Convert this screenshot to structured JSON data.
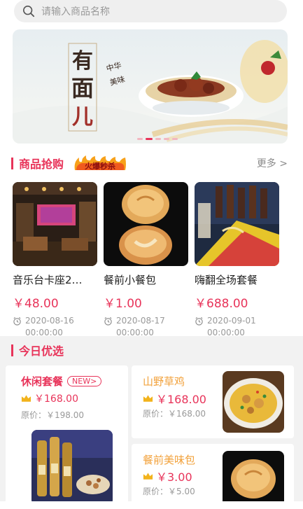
{
  "search": {
    "placeholder": "请输入商品名称",
    "icon": "search-icon"
  },
  "banner": {
    "title_glyphs": "有面儿",
    "subtitle": "中华美味",
    "dots": 5,
    "active_dot": 1
  },
  "flash_sale": {
    "title": "商品抢购",
    "badge": "火爆秒杀",
    "more": "更多 >",
    "items": [
      {
        "name": "音乐台卡座2…",
        "price": "￥48.00",
        "time_date": "2020-08-16",
        "time_clock": "00:00:00"
      },
      {
        "name": "餐前小餐包",
        "price": "￥1.00",
        "time_date": "2020-08-17",
        "time_clock": "00:00:00"
      },
      {
        "name": "嗨翻全场套餐",
        "price": "￥688.00",
        "time_date": "2020-09-01",
        "time_clock": "00:00:00"
      }
    ]
  },
  "today": {
    "title": "今日优选",
    "left_card": {
      "name": "休闲套餐",
      "tag": "NEW>",
      "price": "￥168.00",
      "orig_label": "原价：",
      "orig_price": "￥198.00"
    },
    "right_cards": [
      {
        "name": "山野草鸡",
        "price": "￥168.00",
        "orig_label": "原价：",
        "orig_price": "￥168.00"
      },
      {
        "name": "餐前美味包",
        "price": "￥3.00",
        "orig_label": "原价：",
        "orig_price": "￥5.00"
      }
    ]
  },
  "colors": {
    "accent": "#e8345a",
    "orange": "#f2a23c",
    "muted": "#999999"
  }
}
